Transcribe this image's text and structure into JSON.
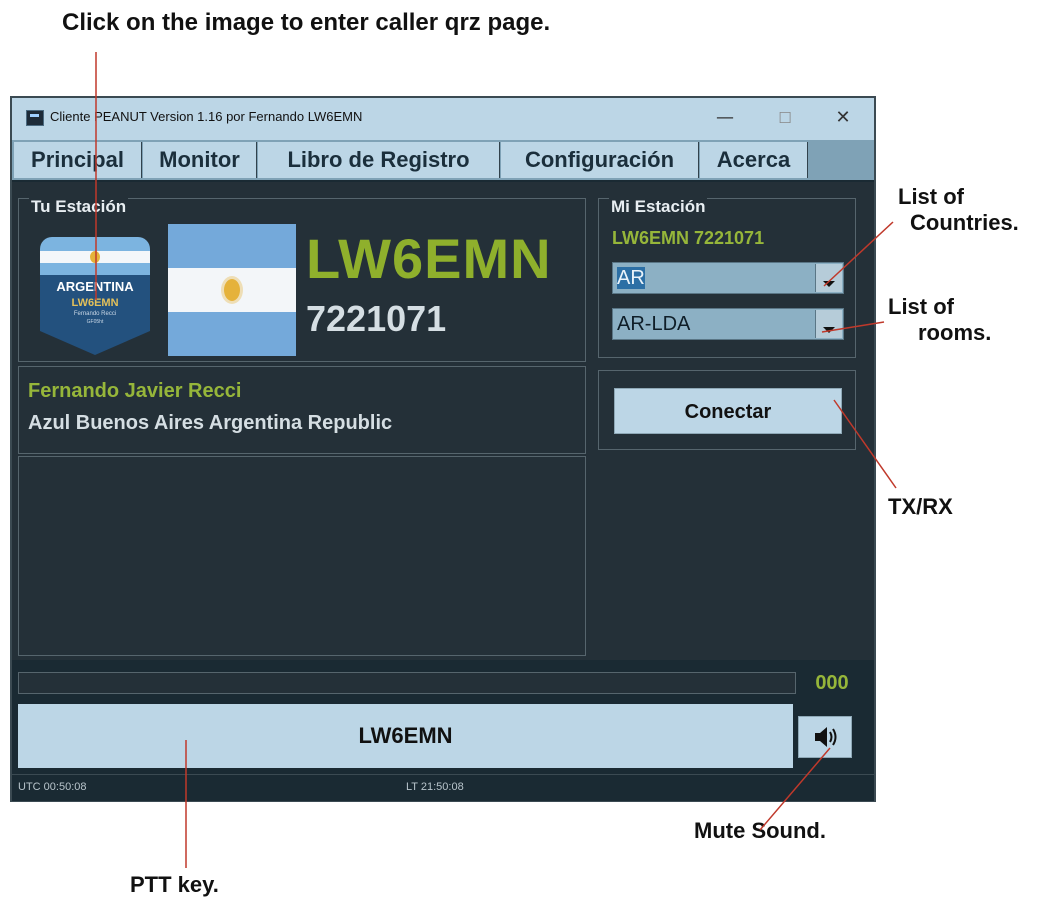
{
  "annotations": {
    "top_note": "Click on the image to enter caller qrz page.",
    "countries_1": "List of",
    "countries_2": "Countries.",
    "rooms_1": "List of",
    "rooms_2": "rooms.",
    "txrx": "TX/RX",
    "mute": "Mute Sound.",
    "ptt": "PTT key."
  },
  "window": {
    "title": "Cliente PEANUT Version 1.16 por Fernando LW6EMN",
    "controls": {
      "minimize": "—",
      "maximize": "☐",
      "close": "✕"
    }
  },
  "tabs": [
    "Principal",
    "Monitor",
    "Libro de Registro",
    "Configuración",
    "Acerca"
  ],
  "tu_estacion": {
    "group_title": "Tu Estación",
    "badge": {
      "country": "ARGENTINA",
      "call": "LW6EMN",
      "line3": "Fernando Recci",
      "line4": "GF05ht"
    },
    "callsign": "LW6EMN",
    "number": "7221071",
    "name": "Fernando Javier Recci",
    "location": "Azul Buenos Aires Argentina Republic"
  },
  "mi_estacion": {
    "group_title": "Mi Estación",
    "call_number": "LW6EMN 7221071",
    "country_select": "AR",
    "room_select": "AR-LDA",
    "connect_button": "Conectar"
  },
  "bottom": {
    "counter": "000",
    "ptt_label": "LW6EMN",
    "mute_icon": "speaker-icon"
  },
  "statusbar": {
    "utc": "UTC 00:50:08",
    "lt": "LT 21:50:08"
  },
  "colors": {
    "accent_green": "#8fb02c",
    "panel_dark": "#243038",
    "button_light": "#bcd6e6"
  }
}
